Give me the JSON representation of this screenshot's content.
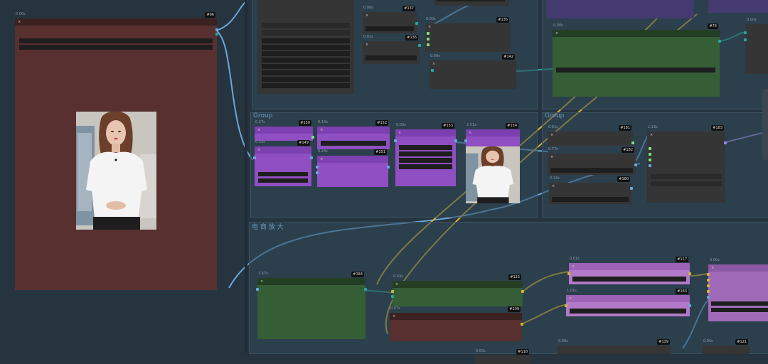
{
  "groups": {
    "group_a": "Group",
    "group_b": "Group",
    "group_c": "电 商 放 大"
  },
  "nodes": {
    "n96": {
      "badge": "#96",
      "time": "0.00s"
    },
    "n137": {
      "badge": "#137",
      "time": "0.00s"
    },
    "n136": {
      "badge": "#136",
      "time": "0.01s"
    },
    "n135": {
      "badge": "#135",
      "time": "0.00s"
    },
    "n142": {
      "badge": "#142",
      "time": "0.00s"
    },
    "n76": {
      "badge": "#76",
      "time": "0.00s"
    },
    "n150": {
      "badge": "#150",
      "time": "0.27s"
    },
    "n149": {
      "badge": "#149",
      "time": "0.22s"
    },
    "n152": {
      "badge": "#152",
      "time": "0.14s"
    },
    "n151": {
      "badge": "#151",
      "time": "0.24s"
    },
    "n153": {
      "badge": "#153",
      "time": "0.00s"
    },
    "n154": {
      "badge": "#154",
      "time": "2.51s"
    },
    "n181": {
      "badge": "#181",
      "time": "0.01s"
    },
    "n182": {
      "badge": "#182",
      "time": "0.77s"
    },
    "n180": {
      "badge": "#180",
      "time": "2.14s"
    },
    "n183": {
      "badge": "#183",
      "time": "1.13s"
    },
    "n184": {
      "badge": "#184",
      "time": "7.57s"
    },
    "n115": {
      "badge": "#115",
      "time": "0.03s"
    },
    "n109": {
      "badge": "#109",
      "time": "0.07s"
    },
    "n117": {
      "badge": "#117",
      "time": "0.01s"
    },
    "n163": {
      "badge": "#163",
      "time": "1.01s"
    },
    "n139": {
      "badge": "#139",
      "time": "0.09s"
    },
    "n121": {
      "badge": "#121",
      "time": "0.05s"
    },
    "n118": {
      "badge": "#118",
      "time": "0.00s"
    }
  },
  "colors": {
    "background": "#263440",
    "brown_node": "#57302f",
    "green_node": "#365e36",
    "purple_node": "#8f4fc2",
    "gray_node": "#353535",
    "wire_yellow": "#d6b532",
    "wire_blue": "#6aa6dc",
    "wire_teal": "#27a79a",
    "wire_purple": "#9a88e0"
  },
  "icons": [
    "close-icon",
    "image-preview"
  ]
}
